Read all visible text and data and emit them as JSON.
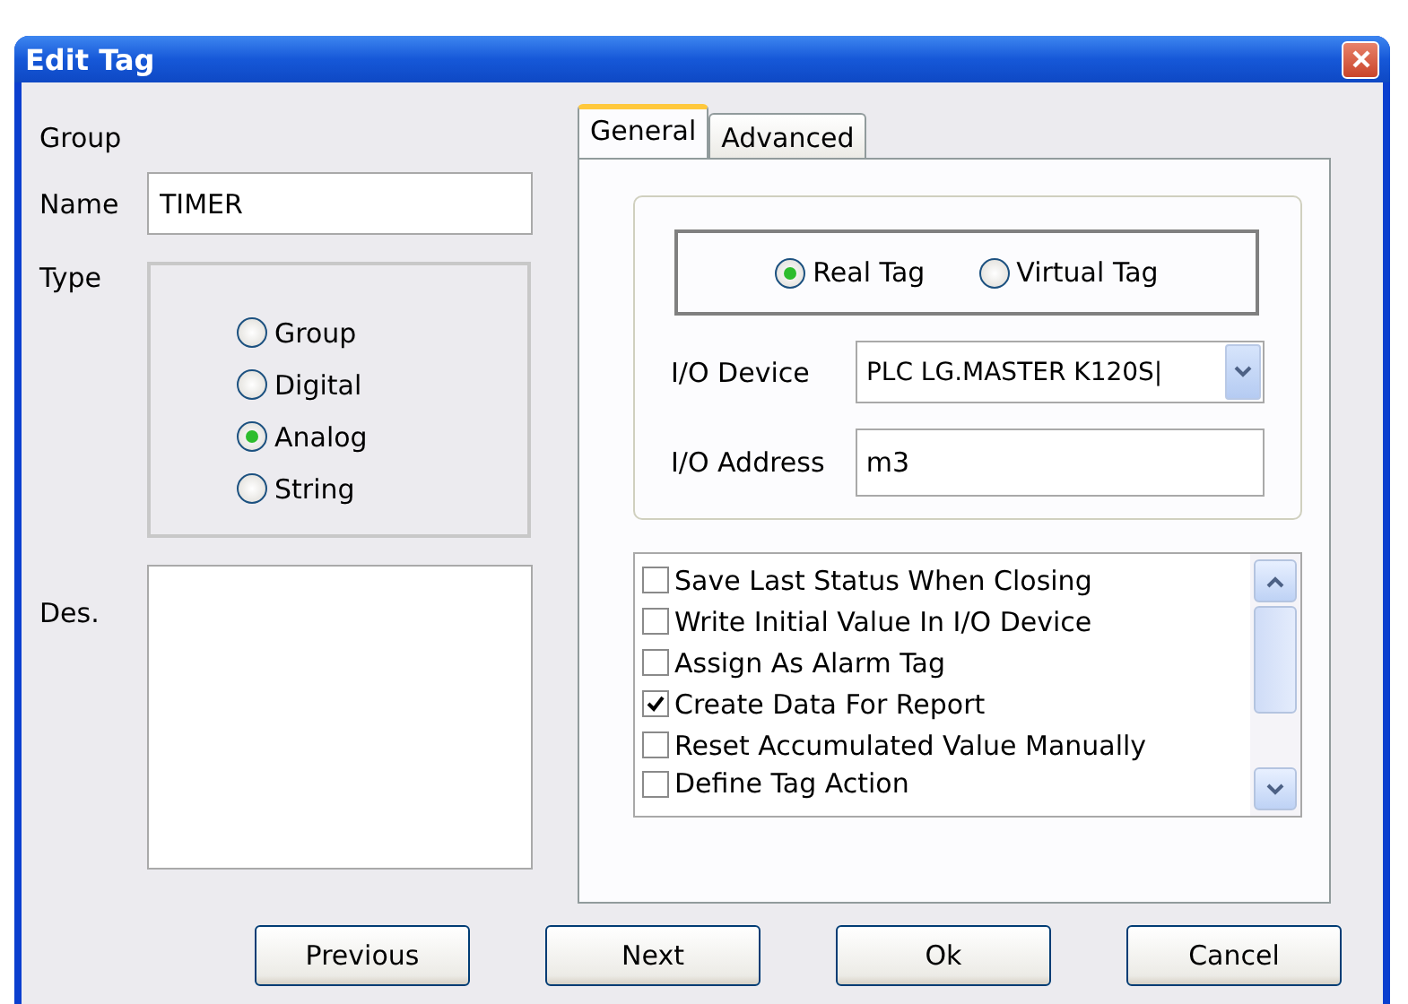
{
  "window": {
    "title": "Edit Tag"
  },
  "left": {
    "group_label": "Group",
    "name_label": "Name",
    "name_value": "TIMER",
    "type_label": "Type",
    "des_label": "Des.",
    "types": [
      {
        "label": "Group",
        "selected": false
      },
      {
        "label": "Digital",
        "selected": false
      },
      {
        "label": "Analog",
        "selected": true
      },
      {
        "label": "String",
        "selected": false
      }
    ]
  },
  "tabs": [
    {
      "label": "General",
      "selected": true
    },
    {
      "label": "Advanced",
      "selected": false
    }
  ],
  "tag_source": [
    {
      "label": "Real Tag",
      "selected": true
    },
    {
      "label": "Virtual Tag",
      "selected": false
    }
  ],
  "io_device": {
    "label": "I/O Device",
    "value": "PLC LG.MASTER K120S|"
  },
  "io_address": {
    "label": "I/O Address",
    "value": "m3"
  },
  "options": [
    {
      "label": "Save Last Status When Closing",
      "checked": false
    },
    {
      "label": "Write Initial Value In I/O Device",
      "checked": false
    },
    {
      "label": "Assign As Alarm Tag",
      "checked": false
    },
    {
      "label": "Create Data For Report",
      "checked": true
    },
    {
      "label": "Reset Accumulated Value Manually",
      "checked": false
    },
    {
      "label": "Define Tag Action",
      "checked": false
    }
  ],
  "buttons": [
    "Previous",
    "Next",
    "Ok",
    "Cancel"
  ]
}
